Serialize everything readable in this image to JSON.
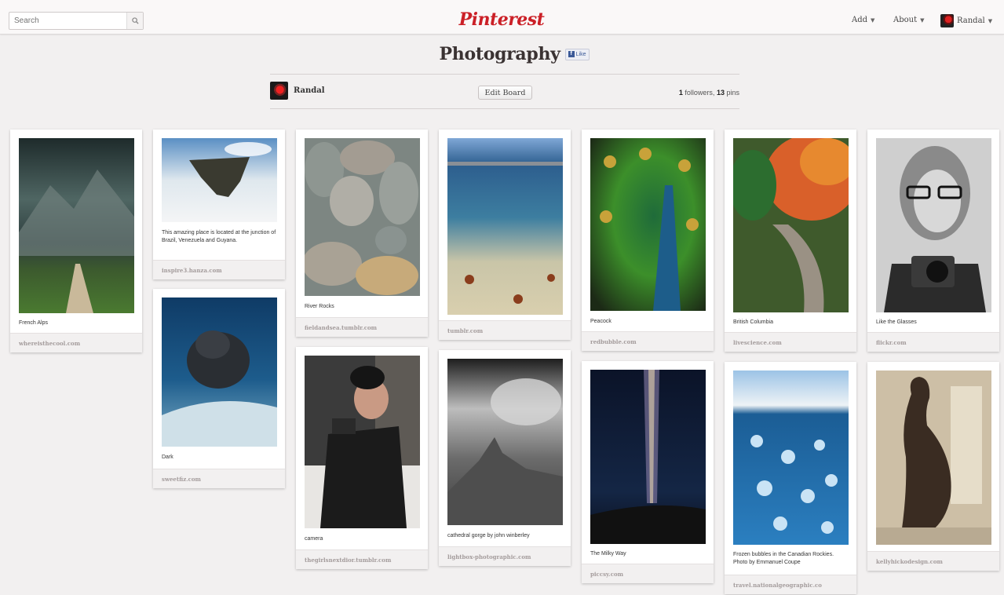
{
  "header": {
    "search_placeholder": "Search",
    "logo": "Pinterest",
    "nav": {
      "add": "Add",
      "about": "About",
      "user": "Randal"
    },
    "caret": "▼"
  },
  "board": {
    "title": "Photography",
    "like_label": "Like",
    "owner": "Randal",
    "edit_button": "Edit Board",
    "followers_count": "1",
    "followers_label": "followers,",
    "pins_count": "13",
    "pins_label": "pins"
  },
  "pins": [
    {
      "description": "French Alps",
      "source": "whereisthecool.com"
    },
    {
      "description": "This amazing place is located at the junction of Brazil, Venezuela and Guyana.",
      "source": "inspire3.hanza.com"
    },
    {
      "description": "Dark",
      "source": "sweetfiz.com"
    },
    {
      "description": "River Rocks",
      "source": "fieldandsea.tumblr.com"
    },
    {
      "description": "camera",
      "source": "thegirlsnextdior.tumblr.com"
    },
    {
      "description": "",
      "source": "tumblr.com"
    },
    {
      "description": "cathedral gorge by john winberley",
      "source": "lightbox-photographic.com"
    },
    {
      "description": "Peacock",
      "source": "redbubble.com"
    },
    {
      "description": "The Milky Way",
      "source": "piccsy.com"
    },
    {
      "description": "British Columbia",
      "source": "livescience.com"
    },
    {
      "description": "Frozen bubbles in the Canadian Rockies. Photo by Emmanuel Coupe",
      "source": "travel.nationalgeographic.co"
    },
    {
      "description": "Like the Glasses",
      "source": "flickr.com"
    },
    {
      "description": "",
      "source": "kellyhickodesign.com"
    }
  ],
  "colors": {
    "brand": "#cb2027",
    "facebook": "#3b5998"
  }
}
